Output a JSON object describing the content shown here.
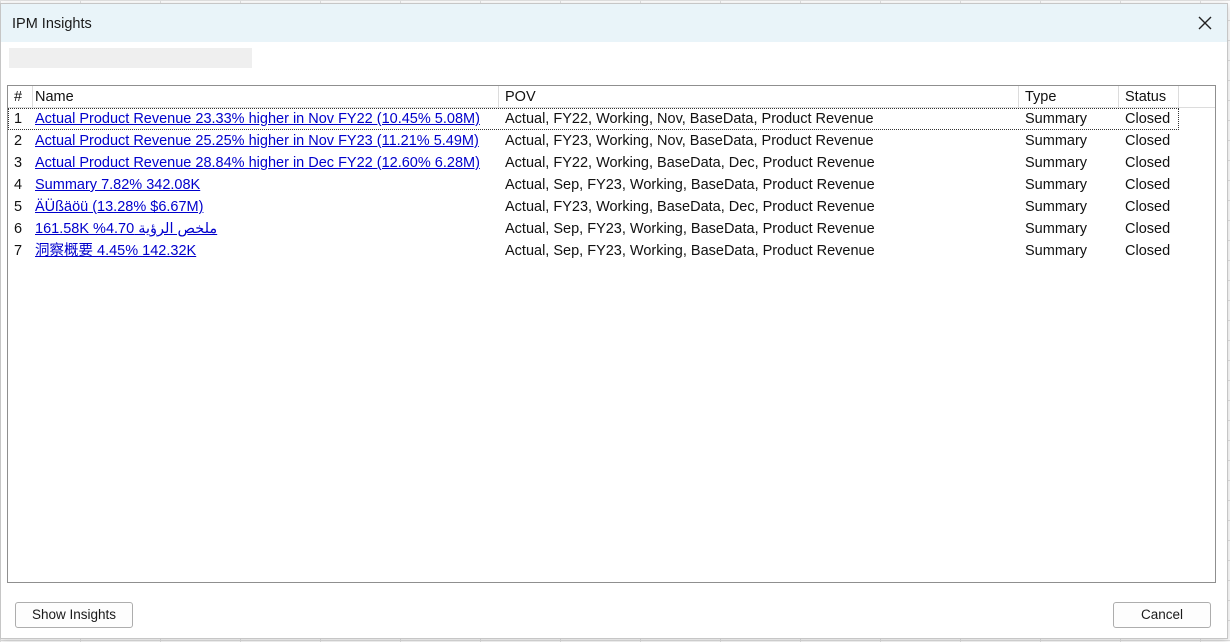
{
  "window": {
    "title": "IPM Insights",
    "close_icon": "close-icon"
  },
  "table": {
    "columns": [
      "#",
      "Name",
      "POV",
      "Type",
      "Status"
    ],
    "rows": [
      {
        "num": "1",
        "name": "Actual Product Revenue 23.33% higher in Nov FY22 (10.45% 5.08M)",
        "pov": "Actual, FY22, Working, Nov, BaseData, Product Revenue",
        "type": "Summary",
        "status": "Closed"
      },
      {
        "num": "2",
        "name": "Actual Product Revenue 25.25% higher in Nov FY23 (11.21% 5.49M)",
        "pov": "Actual, FY23, Working, Nov, BaseData, Product Revenue",
        "type": "Summary",
        "status": "Closed"
      },
      {
        "num": "3",
        "name": "Actual Product Revenue 28.84% higher in Dec FY22 (12.60% 6.28M)",
        "pov": "Actual, FY22, Working, BaseData, Dec, Product Revenue",
        "type": "Summary",
        "status": "Closed"
      },
      {
        "num": "4",
        "name": "Summary 7.82% 342.08K",
        "pov": "Actual, Sep, FY23, Working, BaseData, Product Revenue",
        "type": "Summary",
        "status": "Closed"
      },
      {
        "num": "5",
        "name": "ÄÜßäöü (13.28% $6.67M)",
        "pov": "Actual, FY23, Working, BaseData, Dec, Product Revenue",
        "type": "Summary",
        "status": "Closed"
      },
      {
        "num": "6",
        "name": "ملخص الرؤية 4.70% 161.58K",
        "pov": "Actual, Sep, FY23, Working, BaseData, Product Revenue",
        "type": "Summary",
        "status": "Closed"
      },
      {
        "num": "7",
        "name": "洞察概要 4.45% 142.32K",
        "pov": "Actual, Sep, FY23, Working, BaseData, Product Revenue",
        "type": "Summary",
        "status": "Closed"
      }
    ]
  },
  "buttons": {
    "show_insights": "Show Insights",
    "cancel": "Cancel"
  },
  "colors": {
    "title_bar": "#e9f4f9",
    "link": "#0000cc",
    "grid_lines": "#e2e2e2"
  }
}
